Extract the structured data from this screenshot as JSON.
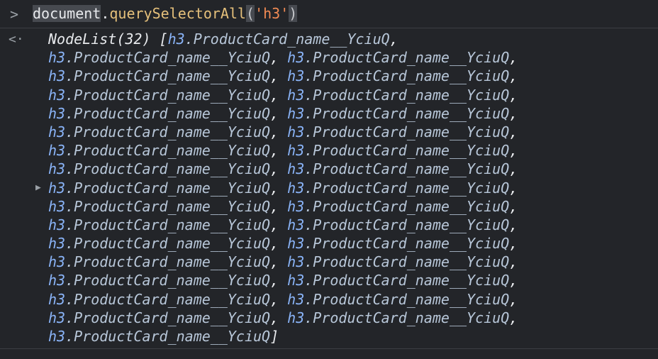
{
  "console": {
    "input": {
      "prompt_icon": ">",
      "object": "document",
      "dot": ".",
      "method": "querySelectorAll",
      "open_paren": "(",
      "argument": "'h3'",
      "close_paren": ")"
    },
    "result": {
      "return_icon": "<·",
      "expand_icon": "▶",
      "nodelist_label": "NodeList(32)",
      "open_bracket": " [",
      "close_bracket": "]",
      "item_tag": "h3",
      "item_class": ".ProductCard_name__YciuQ",
      "separator": ",",
      "spacer": " ",
      "count": 32
    }
  },
  "colors": {
    "background": "#232529",
    "tag": "#8ab4f8",
    "class": "#b8c7d9",
    "method": "#e5c07b",
    "string": "#f28b54"
  }
}
